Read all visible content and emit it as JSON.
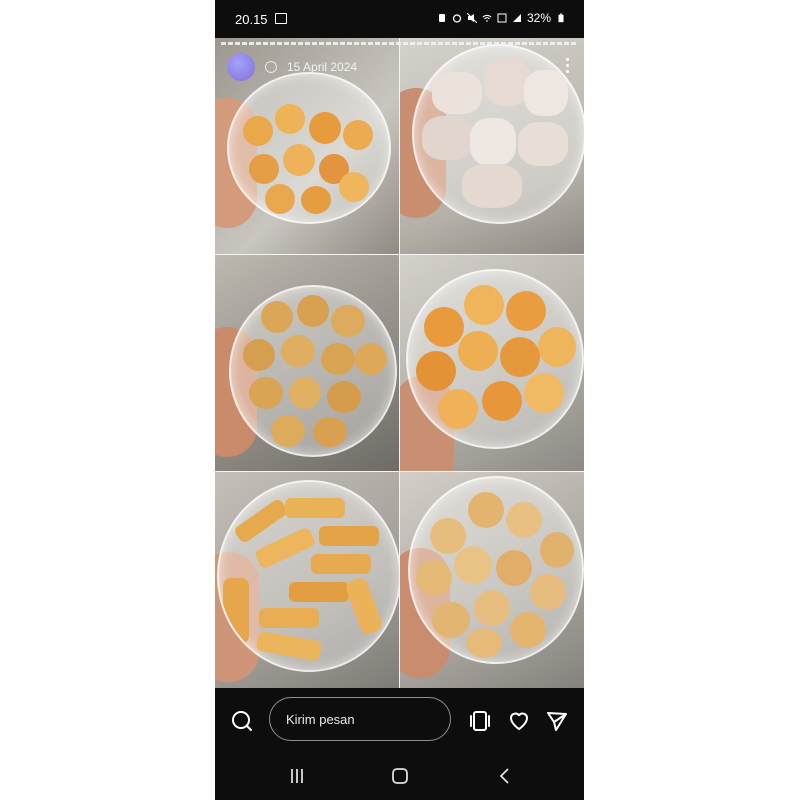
{
  "status_bar": {
    "time": "20.15",
    "battery": "32%"
  },
  "story": {
    "date": "15 April 2024",
    "avatar_text": "",
    "photos": [
      {
        "name": "cheese-cookies",
        "tone": "#e6a44a"
      },
      {
        "name": "snow-cookies",
        "tone": "#eadfd8"
      },
      {
        "name": "choco-chip-cookies",
        "tone": "#d9a75a"
      },
      {
        "name": "nastar-cookies",
        "tone": "#e8a64a"
      },
      {
        "name": "cheese-stick-cookies",
        "tone": "#e4a54c"
      },
      {
        "name": "sprinkle-cookies",
        "tone": "#e2b674"
      }
    ]
  },
  "bottom_bar": {
    "message_placeholder": "Kirim pesan",
    "icons": [
      "camera-icon",
      "reels-icon",
      "heart-icon",
      "send-icon"
    ]
  },
  "nav_bar": {
    "icons": [
      "recents-icon",
      "home-icon",
      "back-icon"
    ]
  }
}
